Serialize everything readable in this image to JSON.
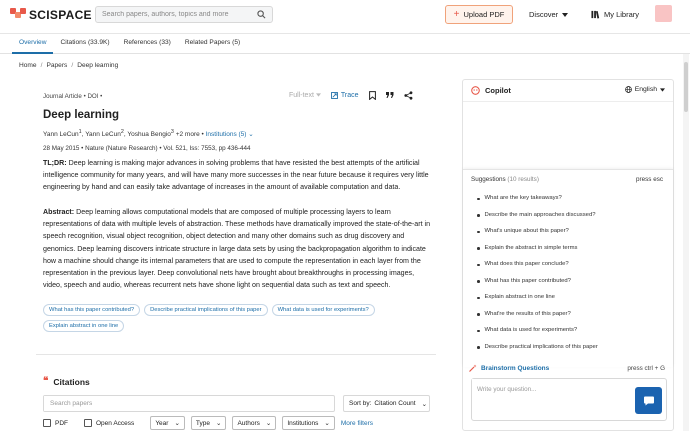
{
  "header": {
    "logo_text": "SCISPACE",
    "search_placeholder": "Search papers, authors, topics and more",
    "upload_label": "Upload PDF",
    "discover_label": "Discover",
    "library_label": "My Library"
  },
  "tabs": [
    {
      "label": "Overview",
      "active": true
    },
    {
      "label": "Citations (33.9K)"
    },
    {
      "label": "References (33)"
    },
    {
      "label": "Related Papers (5)"
    }
  ],
  "breadcrumb": [
    "Home",
    "Papers",
    "Deep learning"
  ],
  "article": {
    "type_line": "Journal Article • DOI •",
    "fulltext_label": "Full-text",
    "trace_label": "Trace",
    "title": "Deep learning",
    "authors": "Yann LeCun",
    "authors_2": "Yann LeCun",
    "authors_3": "Yoshua Bengio",
    "more_authors": "+2 more •",
    "institutions": "Institutions (5)",
    "pub_date": "28 May 2015 •",
    "pub_venue": "Nature (Nature Research) •",
    "pub_vol": "Vol. 521, Iss: 7553, pp 436-444",
    "tldr_label": "TL;DR:",
    "tldr_text": "Deep learning is making major advances in solving problems that have resisted the best attempts of the artificial intelligence community for many years, and will have many more successes in the near future because it requires very little engineering by hand and can easily take advantage of increases in the amount of available computation and data.",
    "abstract_label": "Abstract:",
    "abstract_text": "Deep learning allows computational models that are composed of multiple processing layers to learn representations of data with multiple levels of abstraction. These methods have dramatically improved the state-of-the-art in speech recognition, visual object recognition, object detection and many other domains such as drug discovery and genomics. Deep learning discovers intricate structure in large data sets by using the backpropagation algorithm to indicate how a machine should change its internal parameters that are used to compute the representation in each layer from the representation in the previous layer. Deep convolutional nets have brought about breakthroughs in processing images, video, speech and audio, whereas recurrent nets have shone light on sequential data such as text and speech.",
    "chips": [
      "What has this paper contributed?",
      "Describe practical implications of this paper",
      "What data is used for experiments?",
      "Explain abstract in one line"
    ]
  },
  "citations": {
    "title": "Citations",
    "search_placeholder": "Search papers",
    "sort_prefix": "Sort by:",
    "sort_value": "Citation Count",
    "pdf_label": "PDF",
    "open_access_label": "Open Access",
    "filters": [
      "Year",
      "Type",
      "Authors",
      "Institutions"
    ],
    "more_filters": "More filters"
  },
  "copilot": {
    "title": "Copilot",
    "language": "English",
    "suggestions_label": "Suggestions",
    "suggestions_count": "(10 results)",
    "press_esc": "press esc",
    "suggestions": [
      "What are the key takeaways?",
      "Describe the main approaches discussed?",
      "What's unique about this paper?",
      "Explain the abstract in simple terms",
      "What does this paper conclude?",
      "What has this paper contributed?",
      "Explain abstract in one line",
      "What're the results of this paper?",
      "What data is used for experiments?",
      "Describe practical implications of this paper"
    ],
    "brainstorm_label": "Brainstorm Questions",
    "press_ctrl": "press ctrl + G",
    "question_placeholder": "Write your question..."
  },
  "colors": {
    "accent_blue": "#1d6ea8",
    "brand_orange": "#e8594a",
    "send_button": "#1b63b0"
  }
}
